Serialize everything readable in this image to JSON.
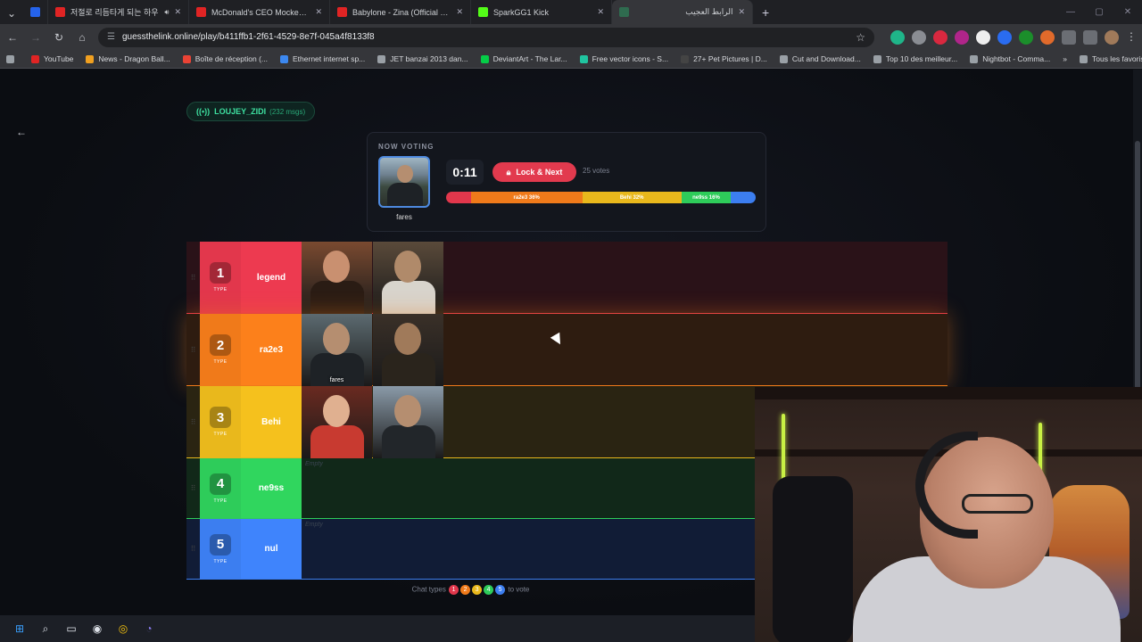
{
  "tabs": [
    {
      "label": "",
      "color": "#2563eb",
      "icon": "linkedin-icon",
      "width": 28
    },
    {
      "label": "저절로 리듬타게 되는 하우",
      "color": "#e02424",
      "icon": "youtube-icon",
      "width": 158,
      "audio": true
    },
    {
      "label": "McDonald's CEO Mocked for H",
      "color": "#e02424",
      "icon": "youtube-icon",
      "width": 158
    },
    {
      "label": "Babylone - Zina (Official Music",
      "color": "#e02424",
      "icon": "youtube-icon",
      "width": 158
    },
    {
      "label": "SparkGG1 Kick",
      "color": "#53fc18",
      "icon": "kick-icon",
      "width": 158
    },
    {
      "label": "الرابط العجيب",
      "color": "#2f6b4f",
      "icon": "site-icon",
      "width": 158,
      "active": true
    }
  ],
  "address": {
    "url": "guessthelink.online/play/b411ffb1-2f61-4529-8e7f-045a4f8133f8"
  },
  "bookmarks": [
    {
      "label": "YouTube",
      "color": "#e02424"
    },
    {
      "label": "News - Dragon Ball...",
      "color": "#f0a020"
    },
    {
      "label": "Boîte de réception (...",
      "color": "#ea4335"
    },
    {
      "label": "Ethernet internet sp...",
      "color": "#3c88f0"
    },
    {
      "label": "JET banzai 2013 dan...",
      "color": "#9aa0a6"
    },
    {
      "label": "DeviantArt - The Lar...",
      "color": "#05cc47"
    },
    {
      "label": "Free vector icons - S...",
      "color": "#20c4a0"
    },
    {
      "label": "27+ Pet Pictures | D...",
      "color": "#444"
    },
    {
      "label": "Cut and Download...",
      "color": "#9aa0a6"
    },
    {
      "label": "Top 10 des meilleur...",
      "color": "#9aa0a6"
    },
    {
      "label": "Nightbot - Comma...",
      "color": "#9aa0a6"
    }
  ],
  "all_bookmarks": "Tous les favoris",
  "chip": {
    "name": "LOUJEY_ZIDI",
    "count": "(232 msgs)"
  },
  "voting": {
    "heading": "NOW VOTING",
    "name": "fares",
    "timer": "0:11",
    "lock_label": "Lock & Next",
    "votes": "25 votes",
    "bar": [
      {
        "label": "",
        "pct": 8,
        "color": "#e2374c"
      },
      {
        "label": "ra2e3 36%",
        "pct": 36,
        "color": "#f07a1a"
      },
      {
        "label": "Behi 32%",
        "pct": 32,
        "color": "#e9b81c"
      },
      {
        "label": "ne9ss 16%",
        "pct": 16,
        "color": "#2ecc5a"
      },
      {
        "label": "",
        "pct": 8,
        "color": "#3c7ef0"
      }
    ]
  },
  "tiers": [
    {
      "num": "1",
      "type": "TYPE",
      "label": "legend",
      "color": "#e2374c",
      "bg": "#2a1218",
      "height": 81,
      "cards": [
        {
          "name": ""
        },
        {
          "name": ""
        }
      ]
    },
    {
      "num": "2",
      "type": "TYPE",
      "label": "ra2e3",
      "color": "#f07a1a",
      "bg": "#2e1c10",
      "height": 81,
      "cards": [
        {
          "name": "fares"
        },
        {
          "name": ""
        }
      ]
    },
    {
      "num": "3",
      "type": "TYPE",
      "label": "Behi",
      "color": "#e9b81c",
      "bg": "#2a2412",
      "height": 81,
      "cards": [
        {
          "name": ""
        },
        {
          "name": ""
        }
      ]
    },
    {
      "num": "4",
      "type": "TYPE",
      "label": "ne9ss",
      "color": "#2ecc5a",
      "bg": "#112819",
      "height": 68,
      "empty": "Empty",
      "cards": []
    },
    {
      "num": "5",
      "type": "TYPE",
      "label": "nul",
      "color": "#3c7ef0",
      "bg": "#111c36",
      "height": 68,
      "empty": "Empty",
      "cards": []
    }
  ],
  "hint": {
    "prefix": "Chat types",
    "suffix": "to vote",
    "dots": [
      {
        "n": "1",
        "color": "#e2374c"
      },
      {
        "n": "2",
        "color": "#f07a1a"
      },
      {
        "n": "3",
        "color": "#e9b81c"
      },
      {
        "n": "4",
        "color": "#2ecc5a"
      },
      {
        "n": "5",
        "color": "#3c7ef0"
      }
    ]
  }
}
